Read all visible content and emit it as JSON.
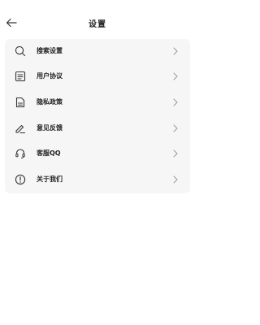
{
  "header": {
    "title": "设置",
    "back_icon": "arrow-left-icon"
  },
  "settings": {
    "items": [
      {
        "label": "搜索设置",
        "icon": "search-icon"
      },
      {
        "label": "用户协议",
        "icon": "document-icon"
      },
      {
        "label": "隐私政策",
        "icon": "file-icon"
      },
      {
        "label": "意见反馈",
        "icon": "edit-icon"
      },
      {
        "label": "客服QQ",
        "icon": "headset-icon"
      },
      {
        "label": "关于我们",
        "icon": "info-icon"
      }
    ]
  },
  "colors": {
    "background": "#ffffff",
    "card": "#f6f6f6",
    "text": "#222222",
    "icon": "#333333",
    "chevron": "#999999"
  }
}
